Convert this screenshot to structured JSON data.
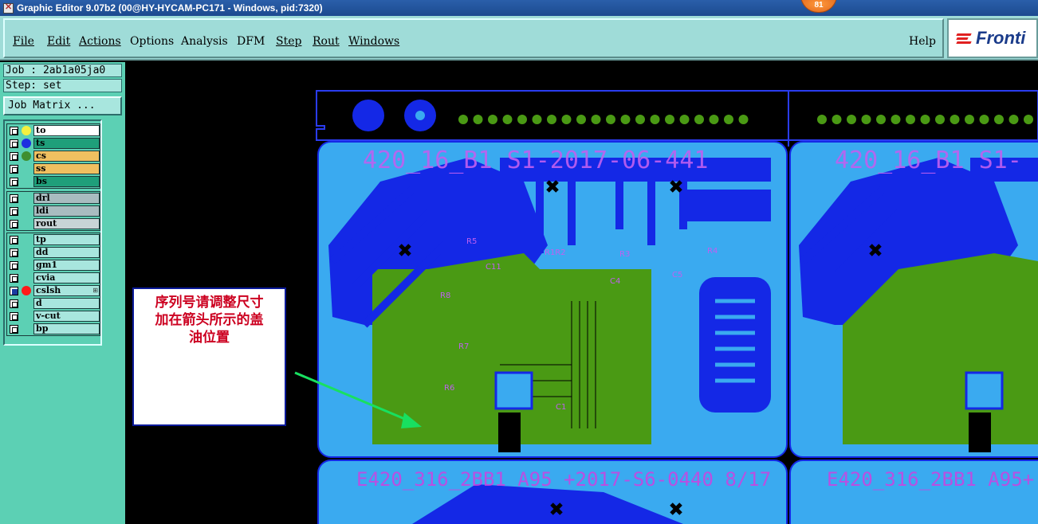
{
  "window": {
    "title": "Graphic Editor 9.07b2 (00@HY-HYCAM-PC171 - Windows, pid:7320)",
    "notification_count": "81"
  },
  "menu": {
    "items": [
      "File",
      "Edit",
      "Actions",
      "Options",
      "Analysis",
      "DFM",
      "Step",
      "Rout",
      "Windows"
    ],
    "help": "Help",
    "logo": "Fronti"
  },
  "job": {
    "job_line": "Job : 2ab1a05ja0",
    "step_line": "Step: set",
    "matrix_button": "Job Matrix ..."
  },
  "layers": {
    "group1": [
      {
        "name": "to",
        "color": "#ffffff",
        "dot": "#f4f040",
        "checked": false
      },
      {
        "name": "ts",
        "color": "#1f9f7a",
        "dot": "#1d2fe0",
        "checked": false
      },
      {
        "name": "cs",
        "color": "#f0c060",
        "dot": "#3f8f30",
        "checked": false
      },
      {
        "name": "ss",
        "color": "#f0c060",
        "dot": "",
        "checked": false
      },
      {
        "name": "bs",
        "color": "#1f9f7a",
        "dot": "",
        "checked": false
      }
    ],
    "group2": [
      {
        "name": "drl",
        "color": "#a8bcc0"
      },
      {
        "name": "ldi",
        "color": "#a8bcc0"
      },
      {
        "name": "rout",
        "color": "#c8d4d6"
      }
    ],
    "group3": [
      {
        "name": "tp",
        "color": "#a8e6de",
        "checked": false,
        "dot": ""
      },
      {
        "name": "dd",
        "color": "#a8e6de",
        "checked": false,
        "dot": ""
      },
      {
        "name": "gm1",
        "color": "#a8e6de",
        "checked": false,
        "dot": ""
      },
      {
        "name": "cvia",
        "color": "#a8e6de",
        "checked": false,
        "dot": ""
      },
      {
        "name": "cslsh",
        "color": "#a8e6de",
        "checked": true,
        "dot": "#ff1a1a"
      },
      {
        "name": "d",
        "color": "#a8e6de",
        "checked": false,
        "dot": ""
      },
      {
        "name": "v-cut",
        "color": "#a8e6de",
        "checked": false,
        "dot": ""
      },
      {
        "name": "bp",
        "color": "#a8e6de",
        "checked": false,
        "dot": ""
      }
    ]
  },
  "canvas": {
    "board_top_text": "420_16_B1 S1-2017-06-441",
    "board_top_text_right": "420_16_B1 S1-",
    "board_bottom_text": "E420_316_2BB1 A95 +2017-S6-0440 8/17",
    "board_bottom_text_right": "E420_316_2BB1 A95+",
    "component_labels": [
      "R5",
      "R1R2",
      "R3",
      "R4",
      "R8",
      "R7",
      "R6",
      "C11",
      "C4",
      "C5",
      "C1"
    ],
    "note_lines": [
      "序列号请调整尺寸",
      "加在箭头所示的盖",
      "油位置"
    ],
    "colors": {
      "background": "#000000",
      "board_light": "#3aaaf0",
      "trace_blue": "#1428e6",
      "copper_green": "#4a9a14",
      "silkscreen": "#c060f0",
      "arrow": "#18e060"
    }
  }
}
